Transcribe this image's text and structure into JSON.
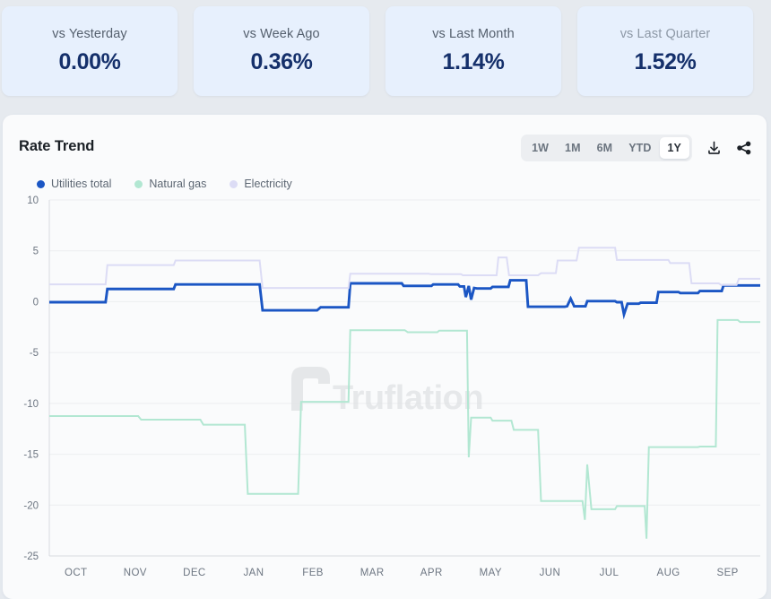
{
  "stats": {
    "cards": [
      {
        "label": "vs Yesterday",
        "value": "0.00%",
        "muted": false
      },
      {
        "label": "vs Week Ago",
        "value": "0.36%",
        "muted": false
      },
      {
        "label": "vs Last Month",
        "value": "1.14%",
        "muted": false
      },
      {
        "label": "vs Last Quarter",
        "value": "1.52%",
        "muted": true
      }
    ]
  },
  "panel": {
    "title": "Rate Trend",
    "watermark": "Truflation",
    "ranges": [
      {
        "label": "1W",
        "active": false
      },
      {
        "label": "1M",
        "active": false
      },
      {
        "label": "6M",
        "active": false
      },
      {
        "label": "YTD",
        "active": false
      },
      {
        "label": "1Y",
        "active": true
      }
    ],
    "download_icon": "download-icon",
    "share_icon": "share-icon"
  },
  "chart_data": {
    "type": "line",
    "title": "Rate Trend",
    "xlabel": "",
    "ylabel": "",
    "ylim": [
      -25,
      10
    ],
    "yticks": [
      10,
      5,
      0,
      -5,
      -10,
      -15,
      -20,
      -25
    ],
    "grid": true,
    "legend_position": "top-left",
    "categories": [
      "OCT",
      "NOV",
      "DEC",
      "JAN",
      "FEB",
      "MAR",
      "APR",
      "MAY",
      "JUN",
      "JUL",
      "AUG",
      "SEP"
    ],
    "step_type": "post",
    "colors": {
      "utilities_total": "#1b56c4",
      "natural_gas": "#b2e7d2",
      "electricity": "#dcdcf5"
    },
    "series": [
      {
        "name": "Utilities total",
        "color": "#1b56c4",
        "points": [
          [
            0.0,
            -0.05
          ],
          [
            0.95,
            -0.05
          ],
          [
            0.98,
            1.25
          ],
          [
            2.1,
            1.25
          ],
          [
            2.13,
            1.7
          ],
          [
            3.55,
            1.7
          ],
          [
            3.6,
            -0.85
          ],
          [
            4.52,
            -0.85
          ],
          [
            4.58,
            -0.55
          ],
          [
            5.05,
            -0.55
          ],
          [
            5.08,
            1.8
          ],
          [
            5.95,
            1.8
          ],
          [
            5.98,
            1.55
          ],
          [
            6.45,
            1.55
          ],
          [
            6.48,
            1.7
          ],
          [
            6.9,
            1.7
          ],
          [
            6.93,
            1.5
          ],
          [
            7.0,
            1.5
          ],
          [
            7.03,
            0.45
          ],
          [
            7.08,
            1.55
          ],
          [
            7.12,
            0.2
          ],
          [
            7.17,
            1.35
          ],
          [
            7.22,
            1.3
          ],
          [
            7.45,
            1.3
          ],
          [
            7.48,
            1.45
          ],
          [
            7.75,
            1.45
          ],
          [
            7.78,
            2.1
          ],
          [
            8.05,
            2.1
          ],
          [
            8.08,
            -0.5
          ],
          [
            8.7,
            -0.5
          ],
          [
            8.74,
            -0.45
          ],
          [
            8.8,
            0.3
          ],
          [
            8.86,
            -0.45
          ],
          [
            9.05,
            -0.45
          ],
          [
            9.08,
            0.05
          ],
          [
            9.55,
            0.05
          ],
          [
            9.58,
            -0.05
          ],
          [
            9.66,
            -0.05
          ],
          [
            9.7,
            -1.25
          ],
          [
            9.76,
            -0.2
          ],
          [
            9.95,
            -0.2
          ],
          [
            9.98,
            -0.1
          ],
          [
            10.25,
            -0.1
          ],
          [
            10.28,
            0.95
          ],
          [
            10.62,
            0.95
          ],
          [
            10.65,
            0.85
          ],
          [
            10.95,
            0.85
          ],
          [
            10.98,
            1.05
          ],
          [
            11.35,
            1.05
          ],
          [
            11.38,
            1.6
          ],
          [
            12.0,
            1.6
          ]
        ]
      },
      {
        "name": "Natural gas",
        "color": "#b2e7d2",
        "points": [
          [
            0.0,
            -11.25
          ],
          [
            1.5,
            -11.25
          ],
          [
            1.55,
            -11.6
          ],
          [
            2.55,
            -11.6
          ],
          [
            2.6,
            -12.1
          ],
          [
            3.3,
            -12.1
          ],
          [
            3.35,
            -18.9
          ],
          [
            4.2,
            -18.9
          ],
          [
            4.25,
            -9.85
          ],
          [
            5.05,
            -9.85
          ],
          [
            5.08,
            -2.8
          ],
          [
            6.0,
            -2.8
          ],
          [
            6.05,
            -3.0
          ],
          [
            6.55,
            -3.0
          ],
          [
            6.58,
            -2.85
          ],
          [
            7.05,
            -2.85
          ],
          [
            7.08,
            -15.3
          ],
          [
            7.12,
            -11.4
          ],
          [
            7.45,
            -11.4
          ],
          [
            7.48,
            -11.7
          ],
          [
            7.8,
            -11.7
          ],
          [
            7.84,
            -12.6
          ],
          [
            8.25,
            -12.6
          ],
          [
            8.3,
            -19.6
          ],
          [
            9.0,
            -19.6
          ],
          [
            9.04,
            -21.45
          ],
          [
            9.08,
            -16.0
          ],
          [
            9.15,
            -20.4
          ],
          [
            9.55,
            -20.4
          ],
          [
            9.58,
            -20.1
          ],
          [
            10.05,
            -20.1
          ],
          [
            10.08,
            -23.3
          ],
          [
            10.12,
            -14.3
          ],
          [
            10.95,
            -14.3
          ],
          [
            10.98,
            -14.25
          ],
          [
            11.25,
            -14.25
          ],
          [
            11.28,
            -1.8
          ],
          [
            11.62,
            -1.8
          ],
          [
            11.66,
            -2.0
          ],
          [
            12.0,
            -2.0
          ]
        ]
      },
      {
        "name": "Electricity",
        "color": "#dcdcf5",
        "points": [
          [
            0.0,
            1.7
          ],
          [
            0.95,
            1.7
          ],
          [
            0.98,
            3.6
          ],
          [
            2.1,
            3.6
          ],
          [
            2.13,
            4.05
          ],
          [
            3.55,
            4.05
          ],
          [
            3.6,
            1.35
          ],
          [
            5.05,
            1.35
          ],
          [
            5.08,
            2.75
          ],
          [
            6.4,
            2.75
          ],
          [
            6.45,
            2.7
          ],
          [
            6.95,
            2.7
          ],
          [
            6.98,
            2.6
          ],
          [
            7.55,
            2.6
          ],
          [
            7.58,
            4.35
          ],
          [
            7.72,
            4.35
          ],
          [
            7.76,
            2.6
          ],
          [
            8.25,
            2.6
          ],
          [
            8.3,
            2.8
          ],
          [
            8.55,
            2.8
          ],
          [
            8.58,
            4.05
          ],
          [
            8.9,
            4.05
          ],
          [
            8.94,
            5.3
          ],
          [
            9.55,
            5.3
          ],
          [
            9.58,
            4.1
          ],
          [
            10.45,
            4.1
          ],
          [
            10.48,
            3.8
          ],
          [
            10.8,
            3.8
          ],
          [
            10.84,
            1.8
          ],
          [
            11.3,
            1.8
          ],
          [
            11.34,
            1.65
          ],
          [
            11.6,
            1.65
          ],
          [
            11.64,
            2.25
          ],
          [
            12.0,
            2.25
          ]
        ]
      }
    ]
  }
}
